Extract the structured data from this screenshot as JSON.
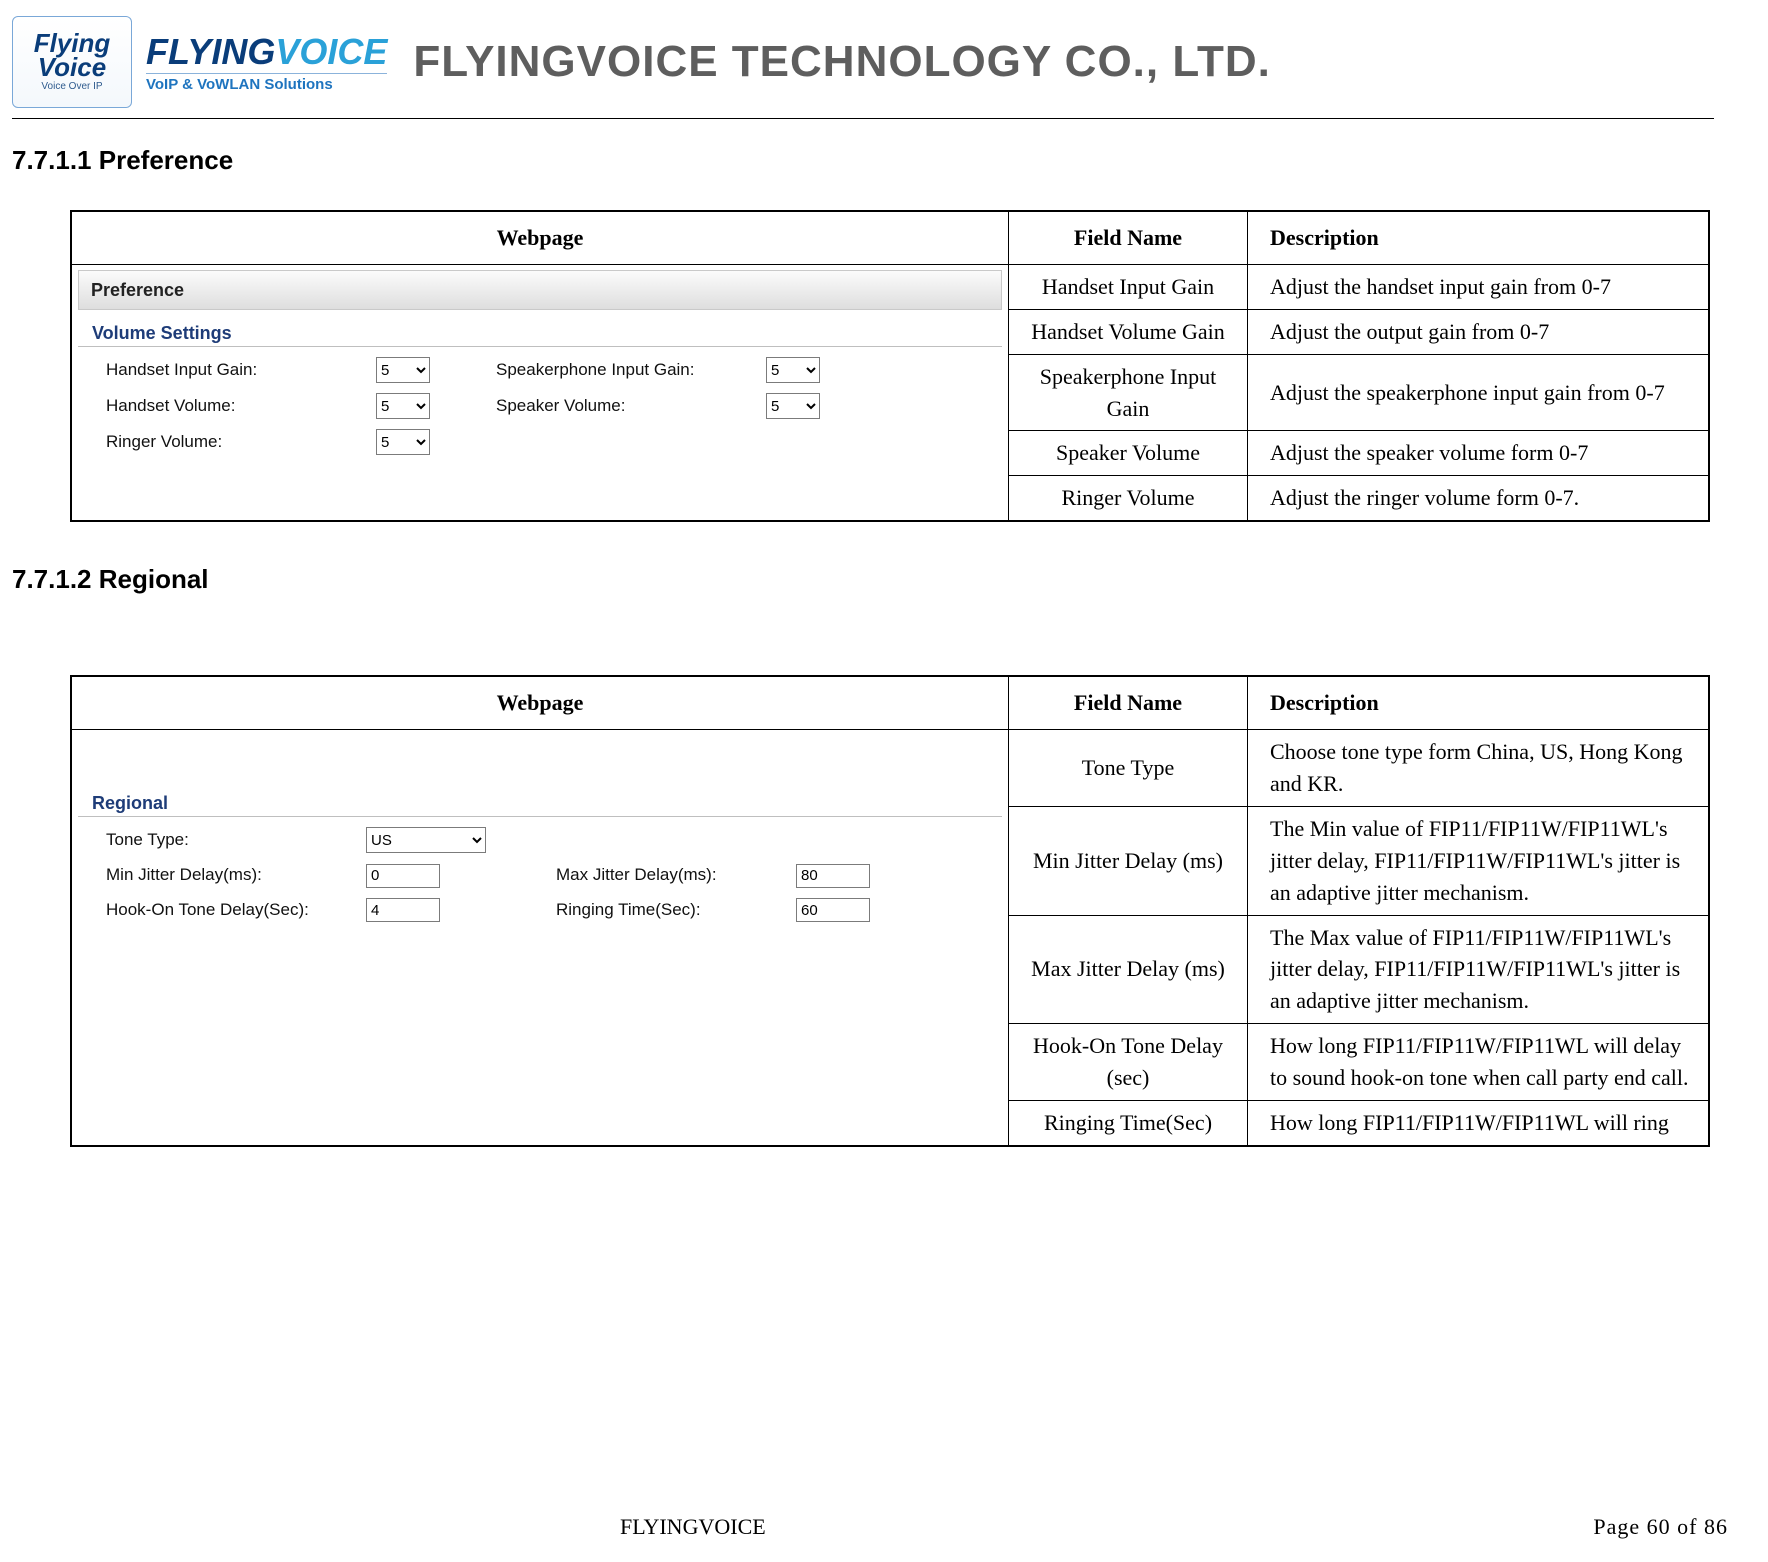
{
  "header": {
    "logo_square": {
      "line1": "Flying",
      "line2": "Voice",
      "sub": "Voice Over IP"
    },
    "logo_wide": {
      "fly": "FLYING",
      "voice": "VOICE",
      "sub": "VoIP & VoWLAN Solutions"
    },
    "company": "FLYINGVOICE TECHNOLOGY CO., LTD."
  },
  "sections": {
    "preference_heading": "7.7.1.1  Preference",
    "regional_heading": "7.7.1.2  Regional"
  },
  "table_headers": {
    "webpage": "Webpage",
    "field_name": "Field Name",
    "description": "Description"
  },
  "preference_shot": {
    "panel_title": "Preference",
    "section_title": "Volume Settings",
    "fields": {
      "handset_input_gain_label": "Handset Input Gain:",
      "handset_volume_label": "Handset Volume:",
      "ringer_volume_label": "Ringer Volume:",
      "speakerphone_input_gain_label": "Speakerphone Input Gain:",
      "speaker_volume_label": "Speaker Volume:"
    },
    "values": {
      "handset_input_gain": "5",
      "handset_volume": "5",
      "ringer_volume": "5",
      "speakerphone_input_gain": "5",
      "speaker_volume": "5"
    }
  },
  "preference_rows": [
    {
      "name": "Handset Input Gain",
      "desc": "Adjust the handset input gain from 0-7"
    },
    {
      "name": "Handset Volume Gain",
      "desc": "Adjust the output gain from 0-7"
    },
    {
      "name": "Speakerphone Input Gain",
      "desc": "Adjust the speakerphone input gain from 0-7"
    },
    {
      "name": "Speaker Volume",
      "desc": "Adjust the speaker volume form 0-7"
    },
    {
      "name": "Ringer Volume",
      "desc": "Adjust the ringer volume form 0-7."
    }
  ],
  "regional_shot": {
    "section_title": "Regional",
    "fields": {
      "tone_type_label": "Tone Type:",
      "min_jitter_label": "Min Jitter Delay(ms):",
      "hook_on_label": "Hook-On Tone Delay(Sec):",
      "max_jitter_label": "Max Jitter Delay(ms):",
      "ringing_time_label": "Ringing Time(Sec):"
    },
    "values": {
      "tone_type": "US",
      "min_jitter": "0",
      "hook_on": "4",
      "max_jitter": "80",
      "ringing_time": "60"
    }
  },
  "regional_rows": [
    {
      "name": "Tone Type",
      "desc": "Choose tone type form China, US, Hong Kong and KR."
    },
    {
      "name": "Min Jitter Delay (ms)",
      "desc": "The Min value of FIP11/FIP11W/FIP11WL's jitter delay, FIP11/FIP11W/FIP11WL's jitter is an adaptive jitter mechanism."
    },
    {
      "name": "Max Jitter Delay (ms)",
      "desc": "The Max value of FIP11/FIP11W/FIP11WL's jitter delay, FIP11/FIP11W/FIP11WL's jitter is an adaptive jitter mechanism."
    },
    {
      "name": "Hook-On Tone Delay (sec)",
      "desc": "How long FIP11/FIP11W/FIP11WL will delay to sound hook-on tone when call party end call."
    },
    {
      "name": "Ringing Time(Sec)",
      "desc": "How long FIP11/FIP11W/FIP11WL will ring"
    }
  ],
  "footer": {
    "left": "FLYINGVOICE",
    "right": "Page  60  of  86"
  }
}
